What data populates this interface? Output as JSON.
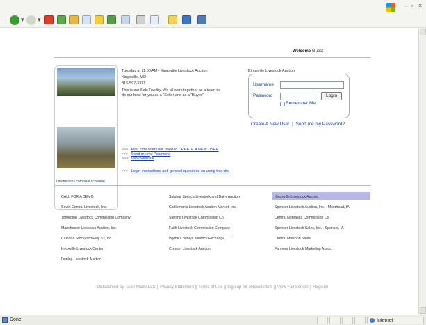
{
  "browser": {
    "status_left": "Done",
    "status_right": "Internet"
  },
  "header": {
    "welcome_label": "Welcome",
    "welcome_user": "Guest"
  },
  "photos": {
    "schedule_link": "Lmafuctions.com sale schedule"
  },
  "info": {
    "line1": "Tuesday at 11:00 AM - Kingsville Livestock Auction",
    "line2": "Kingsville, MO",
    "line3": "816-597-3331",
    "line4": "This is our Sale Facility. We all work together as a team to",
    "line5": "do our best for you as a \"Seller and as a \"Buyer\""
  },
  "links": {
    "first_time": "First time users will need to CREATE A NEW USER",
    "send_password": "Send me my Password",
    "view_website": "View Website",
    "login_instructions": "Login Instructions and general questions on using this site"
  },
  "login": {
    "title": "Kingsville Livestock Auction",
    "username_label": "Username",
    "password_label": "Password",
    "login_button": "Login",
    "remember_label": "Remember Me",
    "create_user": "Create A New User",
    "separator": "|",
    "send_password": "Send me my Password?"
  },
  "auctions": {
    "col1": [
      "CALL FOR A DEMO",
      "South Central Livestock, Inc.",
      "Torrington Livestock Commission Company",
      "Manchester Livestock Auction, Inc.",
      "Calhoun Stockyard Hwy 53, Inc.",
      "Knoxville Livestock Center",
      "Dunlap Livestock Auction"
    ],
    "col2": [
      "Sulphur Springs Livestock and Dairy Auction",
      "Cattlemen's Livestock Auction Market, Inc.",
      "Sterling Livestock Commission Co.",
      "Faith Livestock Commission Company",
      "Wythe County Livestock Exchange, LLC",
      "Creston Livestock Auction"
    ],
    "col3": [
      "Kingsville Livestock Auction",
      "Spencer Livestock Auction, Inc. - Moorhead, IA",
      "Central Nebraska Commission Co.",
      "Spencer Livestock Sales, Inc. - Spencer, IA",
      "Central Missouri Sales",
      "Farmers Livestock Marketing Assoc."
    ]
  },
  "footer": {
    "text": "Outsourced by Tailor Made LLC || Privacy Statement || Terms of Use || Sign up for eNewsletters || View Full Screen || Register"
  },
  "colors": {
    "link": "#1a3fb0",
    "highlight": "#b6b6e8"
  }
}
